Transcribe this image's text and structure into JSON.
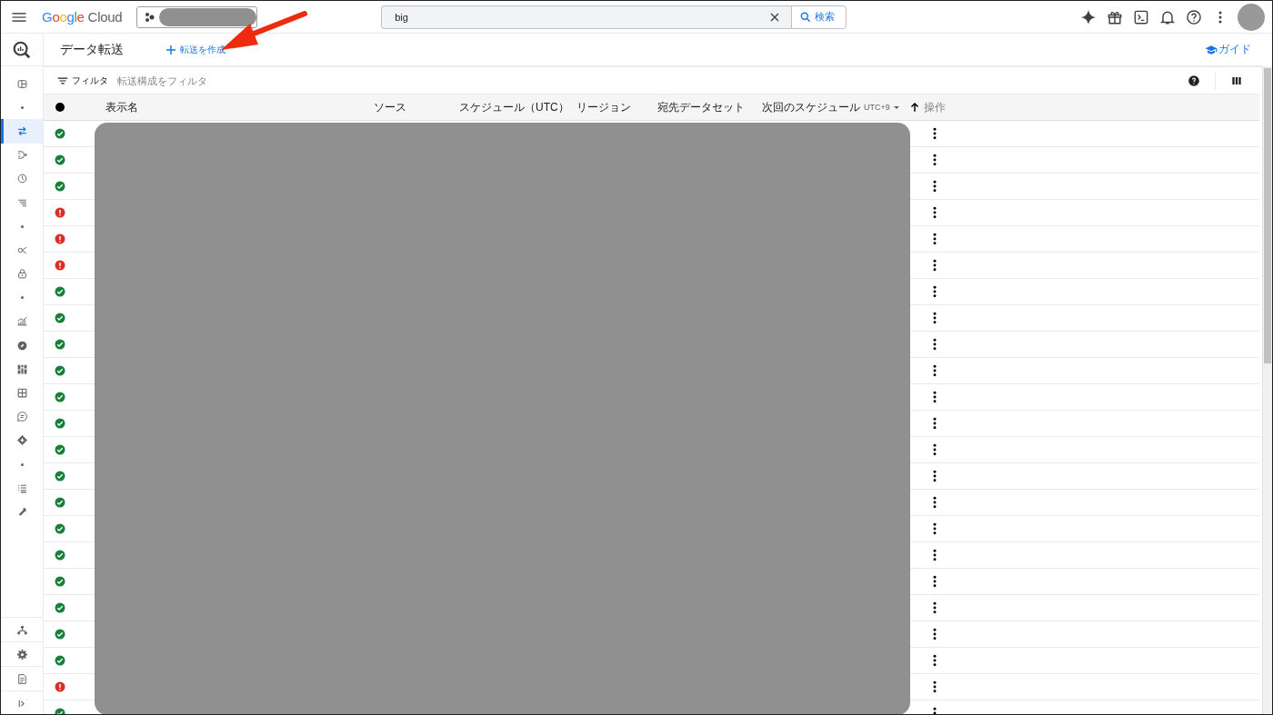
{
  "topbar": {
    "logo_brand": "Google",
    "logo_product": "Cloud",
    "search": {
      "value": "big",
      "button": "検索"
    }
  },
  "sidebar": {
    "items": [
      {
        "kind": "icon",
        "selected": false
      },
      {
        "kind": "dot"
      },
      {
        "kind": "icon",
        "selected": true
      },
      {
        "kind": "icon",
        "selected": false
      },
      {
        "kind": "icon",
        "selected": false
      },
      {
        "kind": "icon",
        "selected": false
      },
      {
        "kind": "dot"
      },
      {
        "kind": "icon",
        "selected": false
      },
      {
        "kind": "icon",
        "selected": false
      },
      {
        "kind": "dot"
      },
      {
        "kind": "icon",
        "selected": false
      },
      {
        "kind": "icon",
        "selected": false
      },
      {
        "kind": "icon",
        "selected": false
      },
      {
        "kind": "icon",
        "selected": false
      },
      {
        "kind": "icon",
        "selected": false
      },
      {
        "kind": "icon",
        "selected": false
      },
      {
        "kind": "dot"
      },
      {
        "kind": "icon",
        "selected": false
      },
      {
        "kind": "icon",
        "selected": false
      }
    ],
    "bottom_items": [
      {
        "kind": "icon"
      },
      {
        "kind": "icon"
      },
      {
        "kind": "icon"
      },
      {
        "kind": "icon"
      }
    ]
  },
  "header": {
    "title": "データ転送",
    "create_button": "転送を作成",
    "guide_link": "ガイド"
  },
  "filter": {
    "label": "フィルタ",
    "placeholder": "転送構成をフィルタ"
  },
  "table": {
    "columns": [
      {
        "label": "表示名"
      },
      {
        "label": "ソース"
      },
      {
        "label": "スケジュール（UTC）"
      },
      {
        "label": "リージョン"
      },
      {
        "label": "宛先データセット"
      },
      {
        "label": "次回のスケジュール",
        "timezone": "UTC+9",
        "sorted": true
      },
      {
        "label": "操作"
      }
    ],
    "rows": [
      {
        "kind": "ok"
      },
      {
        "kind": "ok"
      },
      {
        "kind": "ok"
      },
      {
        "kind": "error"
      },
      {
        "kind": "error"
      },
      {
        "kind": "error"
      },
      {
        "kind": "ok"
      },
      {
        "kind": "ok"
      },
      {
        "kind": "ok"
      },
      {
        "kind": "ok"
      },
      {
        "kind": "ok"
      },
      {
        "kind": "ok"
      },
      {
        "kind": "ok"
      },
      {
        "kind": "ok"
      },
      {
        "kind": "ok"
      },
      {
        "kind": "ok"
      },
      {
        "kind": "ok"
      },
      {
        "kind": "ok"
      },
      {
        "kind": "ok"
      },
      {
        "kind": "ok"
      },
      {
        "kind": "ok"
      },
      {
        "kind": "error"
      },
      {
        "kind": "ok"
      }
    ]
  }
}
